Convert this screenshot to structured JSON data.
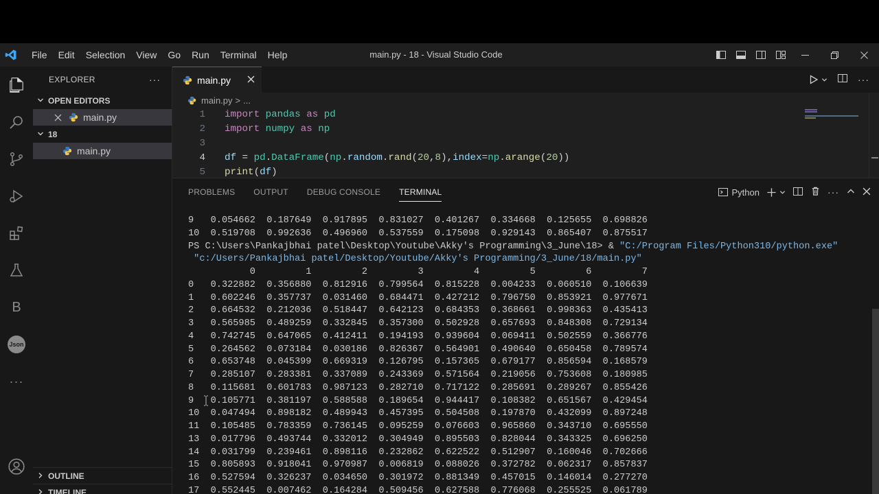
{
  "window": {
    "title": "main.py - 18 - Visual Studio Code",
    "menu": [
      "File",
      "Edit",
      "Selection",
      "View",
      "Go",
      "Run",
      "Terminal",
      "Help"
    ]
  },
  "sidebar": {
    "header": "EXPLORER",
    "more": "···",
    "open_editors_label": "OPEN EDITORS",
    "open_editor_file": "main.py",
    "folder_label": "18",
    "folder_file": "main.py",
    "outline_label": "OUTLINE",
    "timeline_label": "TIMELINE"
  },
  "activity_bar": {
    "icons": [
      "files-icon",
      "search-icon",
      "source-control-icon",
      "run-debug-icon",
      "extensions-icon",
      "testing-icon",
      "b-extension-icon",
      "json-extension-icon",
      "more-icon",
      "account-icon",
      "settings-gear-icon"
    ],
    "b_label": "B",
    "json_label": "Json",
    "more_label": "···"
  },
  "editor": {
    "tab_label": "main.py",
    "breadcrumb_file": "main.py",
    "breadcrumb_sep": ">",
    "breadcrumb_more": "...",
    "lines": [
      {
        "n": "1",
        "tokens": [
          [
            "kw",
            "import"
          ],
          [
            "plain",
            " "
          ],
          [
            "mod",
            "pandas"
          ],
          [
            "plain",
            " "
          ],
          [
            "kw",
            "as"
          ],
          [
            "plain",
            " "
          ],
          [
            "mod",
            "pd"
          ]
        ]
      },
      {
        "n": "2",
        "tokens": [
          [
            "kw",
            "import"
          ],
          [
            "plain",
            " "
          ],
          [
            "mod",
            "numpy"
          ],
          [
            "plain",
            " "
          ],
          [
            "kw",
            "as"
          ],
          [
            "plain",
            " "
          ],
          [
            "mod",
            "np"
          ]
        ]
      },
      {
        "n": "3",
        "tokens": []
      },
      {
        "n": "4",
        "tokens": [
          [
            "var",
            "df"
          ],
          [
            "plain",
            " = "
          ],
          [
            "mod",
            "pd"
          ],
          [
            "plain",
            "."
          ],
          [
            "mod",
            "DataFrame"
          ],
          [
            "plain",
            "("
          ],
          [
            "mod",
            "np"
          ],
          [
            "plain",
            "."
          ],
          [
            "var",
            "random"
          ],
          [
            "plain",
            "."
          ],
          [
            "fn",
            "rand"
          ],
          [
            "plain",
            "("
          ],
          [
            "num",
            "20"
          ],
          [
            "plain",
            ","
          ],
          [
            "num",
            "8"
          ],
          [
            "plain",
            "),"
          ],
          [
            "var",
            "index"
          ],
          [
            "plain",
            "="
          ],
          [
            "mod",
            "np"
          ],
          [
            "plain",
            "."
          ],
          [
            "fn",
            "arange"
          ],
          [
            "plain",
            "("
          ],
          [
            "num",
            "20"
          ],
          [
            "plain",
            "))"
          ]
        ]
      },
      {
        "n": "5",
        "tokens": [
          [
            "fn",
            "print"
          ],
          [
            "plain",
            "("
          ],
          [
            "var",
            "df"
          ],
          [
            "plain",
            ")"
          ]
        ]
      }
    ]
  },
  "panel": {
    "tabs": [
      "PROBLEMS",
      "OUTPUT",
      "DEBUG CONSOLE",
      "TERMINAL"
    ],
    "active_tab": "TERMINAL",
    "terminal_profile": "Python",
    "terminal": {
      "prev_rows": [
        "9   0.054662  0.187649  0.917895  0.831027  0.401267  0.334668  0.125655  0.698826",
        "10  0.519708  0.992636  0.496960  0.537559  0.175098  0.929143  0.865407  0.875517"
      ],
      "prompt": "PS C:\\Users\\Pankajbhai patel\\Desktop\\Youtube\\Akky's Programming\\3_June\\18> & ",
      "exe": "\"C:/Program Files/Python310/python.exe\"",
      "script": " \"c:/Users/Pankajbhai patel/Desktop/Youtube/Akky's Programming/3_June/18/main.py\"",
      "header": "           0         1         2         3         4         5         6         7",
      "rows": [
        "0   0.322882  0.356880  0.812916  0.799564  0.815228  0.004233  0.060510  0.106639",
        "1   0.602246  0.357737  0.031460  0.684471  0.427212  0.796750  0.853921  0.977671",
        "2   0.664532  0.212036  0.518447  0.642123  0.684353  0.368661  0.998363  0.435413",
        "3   0.565985  0.489259  0.332845  0.357300  0.502928  0.657693  0.848308  0.729134",
        "4   0.742745  0.647065  0.412411  0.194193  0.939604  0.069411  0.502559  0.366776",
        "5   0.264562  0.073184  0.030186  0.826367  0.564901  0.490640  0.650458  0.789574",
        "6   0.653748  0.045399  0.669319  0.126795  0.157365  0.679177  0.856594  0.168579",
        "7   0.285107  0.283381  0.337089  0.243369  0.571564  0.219056  0.753608  0.180985",
        "8   0.115681  0.601783  0.987123  0.282710  0.717122  0.285691  0.289267  0.855426",
        "9   0.105771  0.381197  0.588588  0.189654  0.944417  0.108382  0.651567  0.429454",
        "10  0.047494  0.898182  0.489943  0.457395  0.504508  0.197870  0.432099  0.897248",
        "11  0.105485  0.783359  0.736145  0.095259  0.076603  0.965860  0.343710  0.695550",
        "13  0.017796  0.493744  0.332012  0.304949  0.895503  0.828044  0.343325  0.696250",
        "14  0.031799  0.239461  0.898116  0.232862  0.622522  0.512907  0.160046  0.702666",
        "15  0.805893  0.918041  0.970987  0.006819  0.088026  0.372782  0.062317  0.857837",
        "16  0.527594  0.326237  0.034650  0.301972  0.881349  0.457015  0.146014  0.277270",
        "17  0.552445  0.007462  0.164284  0.509456  0.627588  0.776068  0.255525  0.061789"
      ]
    }
  },
  "colors": {
    "accent": "#0078d4",
    "editor_bg": "#1f1f1f",
    "sidebar_bg": "#181818"
  }
}
